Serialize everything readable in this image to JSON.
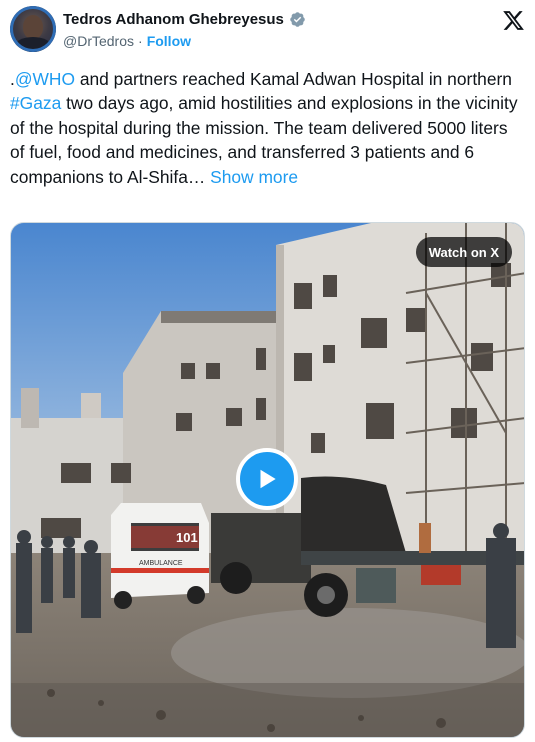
{
  "author": {
    "name": "Tedros Adhanom Ghebreyesus",
    "handle": "@DrTedros",
    "separator": "·",
    "follow_label": "Follow"
  },
  "icons": {
    "verified": "verified-badge-icon",
    "platform": "x-logo-icon",
    "play": "play-icon"
  },
  "tweet": {
    "prefix": ".",
    "mention": "@WHO",
    "part1": " and partners reached Kamal Adwan Hospital in northern ",
    "hashtag": "#Gaza",
    "part2": " two days ago, amid hostilities and explosions in the vicinity of the hospital during the mission. The team delivered 5000 liters of fuel, food and medicines, and transferred 3 patients and 6 companions to Al-Shifa…",
    "show_more": "Show more"
  },
  "media": {
    "watch_label": "Watch on X",
    "ambulance_text": "AMBULANCE",
    "ambulance_number": "101"
  },
  "colors": {
    "accent": "#1d9bf0",
    "text": "#0f1419",
    "muted": "#536471"
  }
}
